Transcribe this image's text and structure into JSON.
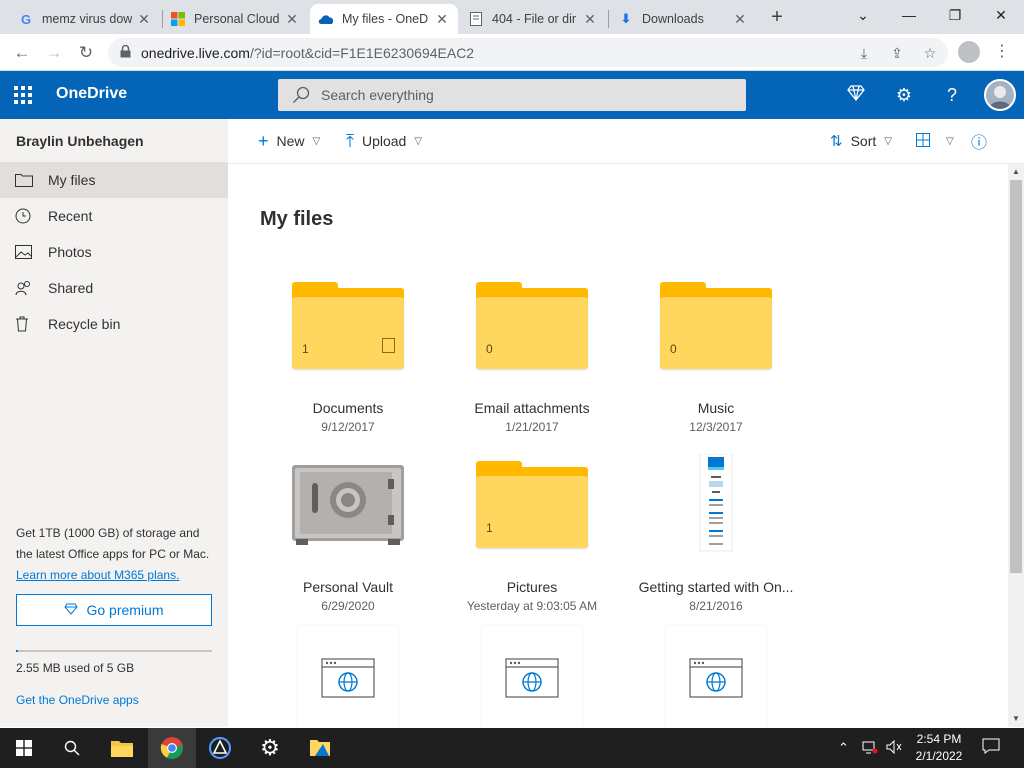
{
  "browser": {
    "tabs": [
      {
        "title": "memz virus dow",
        "favicon": "google-g",
        "active": false
      },
      {
        "title": "Personal Cloud",
        "favicon": "microsoft-logo",
        "active": false
      },
      {
        "title": "My files - OneD",
        "favicon": "onedrive-cloud",
        "active": true
      },
      {
        "title": "404 - File or dir",
        "favicon": "page-icon",
        "active": false
      },
      {
        "title": "Downloads",
        "favicon": "download-icon",
        "active": false
      }
    ],
    "url_host": "onedrive.live.com",
    "url_rest": "/?id=root&cid=F1E1E6230694EAC2"
  },
  "header": {
    "brand": "OneDrive",
    "search_placeholder": "Search everything",
    "accent": "#0364b8"
  },
  "sidebar": {
    "user": "Braylin Unbehagen",
    "items": [
      {
        "label": "My files",
        "icon": "folder-icon",
        "selected": true
      },
      {
        "label": "Recent",
        "icon": "clock-icon",
        "selected": false
      },
      {
        "label": "Photos",
        "icon": "image-icon",
        "selected": false
      },
      {
        "label": "Shared",
        "icon": "people-icon",
        "selected": false
      },
      {
        "label": "Recycle bin",
        "icon": "trash-icon",
        "selected": false
      }
    ],
    "promo_text": "Get 1TB (1000 GB) of storage and the latest Office apps for PC or Mac.",
    "promo_link": "Learn more about M365 plans.",
    "premium_label": "Go premium",
    "quota_text": "2.55 MB used of 5 GB",
    "quota_fraction": 0.0005,
    "apps_link": "Get the OneDrive apps"
  },
  "commands": {
    "new_label": "New",
    "upload_label": "Upload",
    "sort_label": "Sort"
  },
  "main": {
    "title": "My files",
    "items": [
      {
        "name": "Documents",
        "date": "9/12/2017",
        "type": "folder",
        "count": "1",
        "has_doc": true
      },
      {
        "name": "Email attachments",
        "date": "1/21/2017",
        "type": "folder",
        "count": "0",
        "has_doc": false
      },
      {
        "name": "Music",
        "date": "12/3/2017",
        "type": "folder",
        "count": "0",
        "has_doc": false
      },
      {
        "name": "Personal Vault",
        "date": "6/29/2020",
        "type": "vault"
      },
      {
        "name": "Pictures",
        "date": "Yesterday at 9:03:05 AM",
        "type": "folder",
        "count": "1",
        "has_doc": false
      },
      {
        "name": "Getting started with On...",
        "date": "8/21/2016",
        "type": "pdf"
      }
    ]
  },
  "taskbar": {
    "time": "2:54 PM",
    "date": "2/1/2022"
  }
}
